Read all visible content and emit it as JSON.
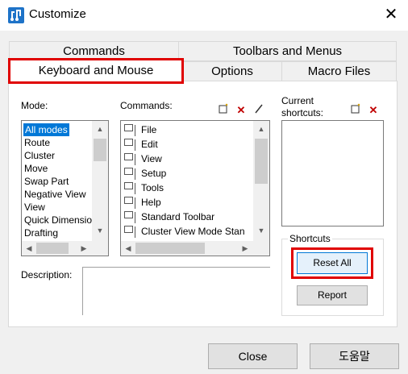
{
  "window": {
    "title": "Customize",
    "close_glyph": "✕"
  },
  "tabs": {
    "row1": [
      "Commands",
      "Toolbars and Menus"
    ],
    "row2": [
      "Keyboard and Mouse",
      "Options",
      "Macro Files"
    ]
  },
  "mode": {
    "label": "Mode:",
    "items": [
      "All modes",
      "Route",
      "Cluster",
      "Move",
      "Swap Part",
      "Negative View",
      "View",
      "Quick Dimensio",
      "Drafting"
    ]
  },
  "commands": {
    "label": "Commands:",
    "items": [
      "File",
      "Edit",
      "View",
      "Setup",
      "Tools",
      "Help",
      "Standard Toolbar",
      "Cluster View Mode Stan"
    ]
  },
  "shortcuts": {
    "label": "Current shortcuts:",
    "group_label": "Shortcuts",
    "reset_all": "Reset All",
    "report": "Report"
  },
  "description": {
    "label": "Description:"
  },
  "footer": {
    "close": "Close",
    "help": "도움말"
  },
  "colors": {
    "highlight": "#e00000",
    "selection": "#0078d7"
  },
  "icons": [
    "app-icon",
    "new-icon",
    "delete-icon",
    "rename-icon",
    "close-icon"
  ]
}
